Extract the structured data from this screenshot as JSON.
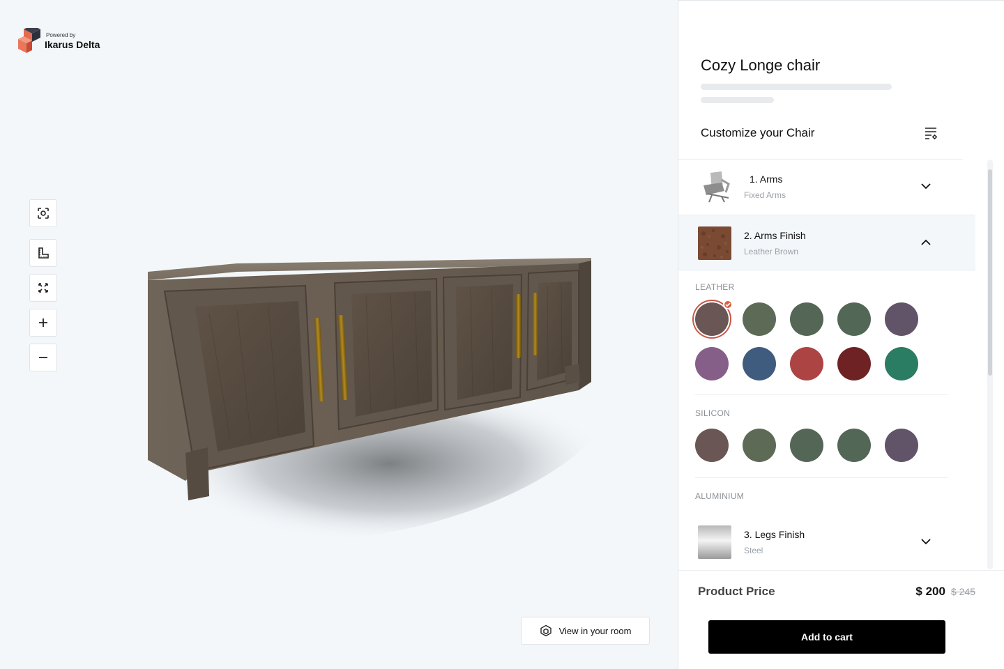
{
  "brand": {
    "powered_by": "Powered by",
    "name": "Ikarus Delta"
  },
  "viewer": {
    "tools": [
      "focus-icon",
      "measure-icon",
      "fullscreen-icon",
      "zoom-in-icon",
      "zoom-out-icon"
    ],
    "view_in_room_label": "View in your room"
  },
  "product": {
    "title": "Cozy Longe chair"
  },
  "customize": {
    "title": "Customize your Chair"
  },
  "accordion": [
    {
      "title": "1. Arms",
      "subtitle": "Fixed Arms",
      "expanded": false
    },
    {
      "title": "2. Arms Finish",
      "subtitle": "Leather Brown",
      "expanded": true
    },
    {
      "title": "3. Legs Finish",
      "subtitle": "Steel",
      "expanded": false
    }
  ],
  "finish_groups": [
    {
      "label": "LEATHER",
      "swatches": [
        "#6a5654",
        "#5d6a56",
        "#546656",
        "#536757",
        "#615468",
        "#855f88",
        "#3f5b7e",
        "#ad4444",
        "#6e2224",
        "#2a7c62"
      ],
      "selected_index": 0
    },
    {
      "label": "SILICON",
      "swatches": [
        "#6a5654",
        "#5d6a56",
        "#546656",
        "#536757",
        "#615468"
      ]
    },
    {
      "label": "ALUMINIUM",
      "swatches": []
    }
  ],
  "price": {
    "label": "Product Price",
    "current": "$ 200",
    "original": "$ 245"
  },
  "cart": {
    "label": "Add to cart"
  },
  "colors": {
    "accent": "#d9603f",
    "brand_dark": "#2d2f3a",
    "brand_orange": "#e86a4d"
  }
}
